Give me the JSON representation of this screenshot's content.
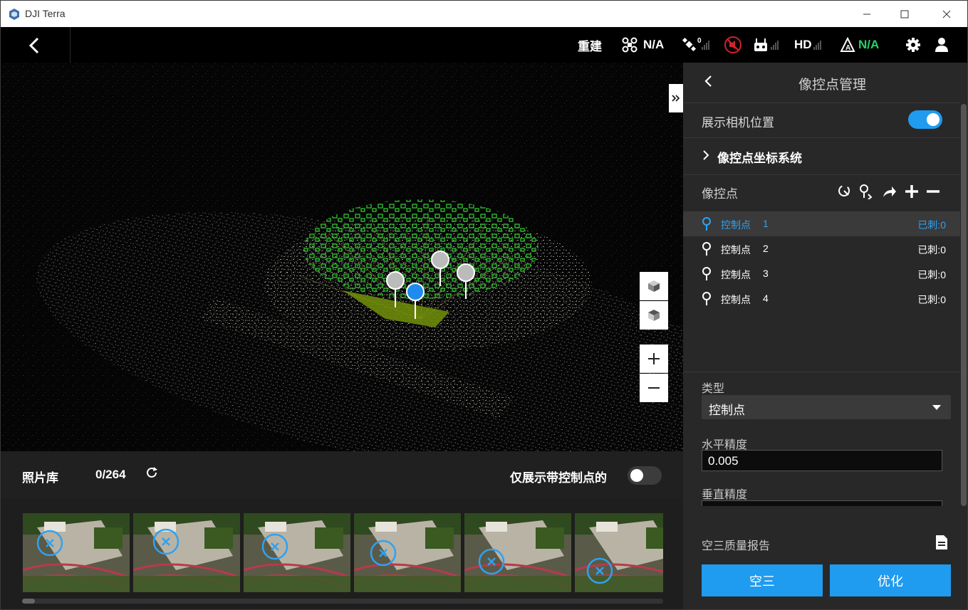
{
  "window": {
    "title": "DJI Terra"
  },
  "topbar": {
    "rebuild_label": "重建",
    "drone_status": "N/A",
    "gps_count": "0",
    "hd_label": "HD",
    "rtk_status": "N/A",
    "icons": [
      "back-icon",
      "drone-icon",
      "satellite-icon",
      "speaker-icon",
      "remote-controller-icon",
      "hd-signal-icon",
      "rtk-icon",
      "gear-icon",
      "user-icon"
    ]
  },
  "photos": {
    "library_label": "照片库",
    "count": "0/264",
    "filter_label": "仅展示带控制点的",
    "filter_on": false,
    "thumbnail_count": 6
  },
  "panel": {
    "title": "像控点管理",
    "show_camera_label": "展示相机位置",
    "show_camera_on": true,
    "coord_system_label": "像控点坐标系统",
    "gcp_section_label": "像控点",
    "gcps": [
      {
        "label": "控制点",
        "num": "1",
        "status": "已刺:0",
        "selected": true
      },
      {
        "label": "控制点",
        "num": "2",
        "status": "已刺:0",
        "selected": false
      },
      {
        "label": "控制点",
        "num": "3",
        "status": "已刺:0",
        "selected": false
      },
      {
        "label": "控制点",
        "num": "4",
        "status": "已刺:0",
        "selected": false
      }
    ],
    "type_label": "类型",
    "type_value": "控制点",
    "horiz_label": "水平精度",
    "horiz_value": "0.005",
    "vert_label": "垂直精度",
    "report_label": "空三质量报告",
    "aerotriangulation_button": "空三",
    "optimize_button": "优化"
  },
  "colors": {
    "accent": "#1f9bef",
    "rtk_green": "#21d36b",
    "panel_bg": "#282828"
  }
}
